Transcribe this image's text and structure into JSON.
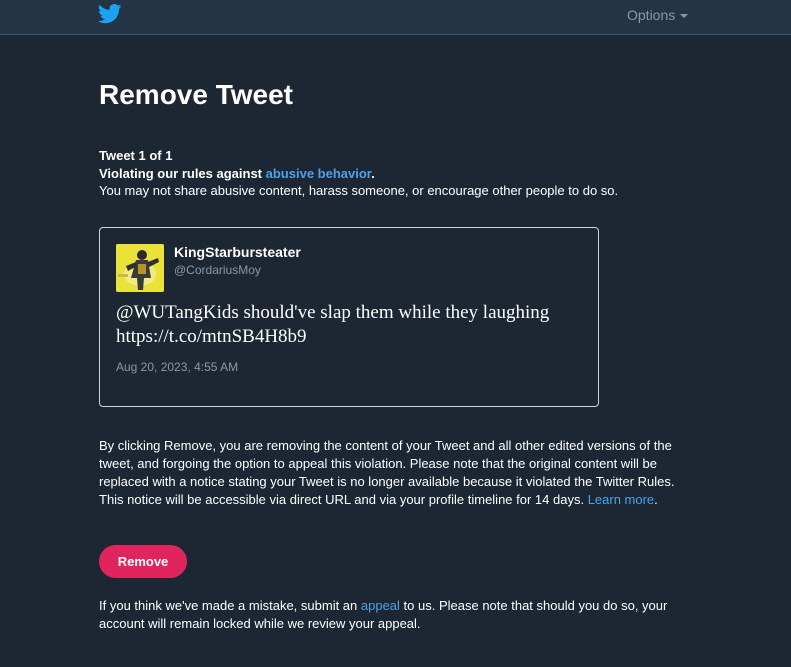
{
  "header": {
    "logo": "twitter-bird-icon",
    "options_label": "Options"
  },
  "page": {
    "title": "Remove Tweet",
    "counter": "Tweet 1 of 1",
    "violation_prefix": "Violating our rules against ",
    "violation_link": "abusive behavior",
    "violation_suffix": ".",
    "violation_description": "You may not share abusive content, harass someone, or encourage other people to do so."
  },
  "tweet": {
    "display_name": "KingStarbursteater",
    "handle": "@CordariusMoy",
    "text_line1": "@WUTangKids should've slap them while they laughing",
    "text_line2": "https://t.co/mtnSB4H8b9",
    "timestamp": "Aug 20, 2023, 4:55 AM"
  },
  "disclaimer": {
    "text": "By clicking Remove, you are removing the content of your Tweet and all other edited versions of the tweet, and forgoing the option to appeal this violation. Please note that the original content will be replaced with a notice stating your Tweet is no longer available because it violated the Twitter Rules. This notice will be accessible via direct URL and via your profile timeline for 14 days. ",
    "learn_more": "Learn more",
    "suffix": "."
  },
  "actions": {
    "remove_label": "Remove"
  },
  "appeal": {
    "prefix": "If you think we've made a mistake, submit an ",
    "link": "appeal",
    "suffix": " to us. Please note that should you do so, your account will remain locked while we review your appeal."
  },
  "colors": {
    "background": "#1c2733",
    "topbar": "#243447",
    "accent_link": "#4ba3ea",
    "remove_button": "#e0245e",
    "muted_text": "#8899a6"
  }
}
